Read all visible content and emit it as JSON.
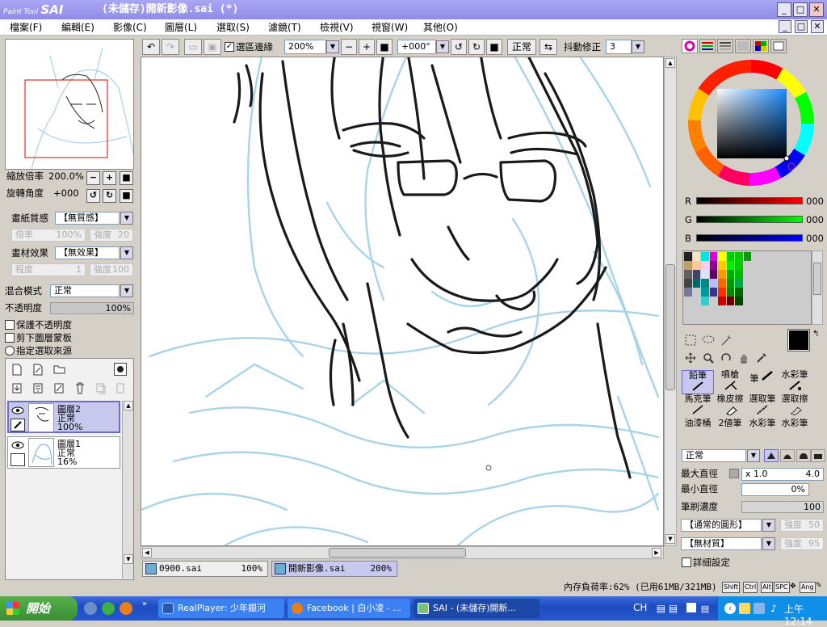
{
  "window": {
    "logo_small": "Paint Tool",
    "logo": "SAI",
    "title": "(未儲存)開新影像.sai (*)",
    "min": "_",
    "max": "□",
    "close": "✕"
  },
  "menu": {
    "items": [
      "檔案(F)",
      "編輯(E)",
      "影像(C)",
      "圖層(L)",
      "選取(S)",
      "濾鏡(T)",
      "檢視(V)",
      "視窗(W)",
      "其他(O)"
    ],
    "mdi_min": "_",
    "mdi_max": "□",
    "mdi_close": "✕"
  },
  "navigator": {
    "zoom_label": "縮放倍率",
    "zoom_value": "200.0%",
    "rotate_label": "旋轉角度",
    "rotate_value": "+000"
  },
  "paper": {
    "texture_label": "畫紙質感",
    "texture_value": "【無質感】",
    "scale_label": "倍率",
    "scale_value": "100%",
    "strength_label": "強度",
    "strength_value": "20",
    "effect_label": "畫材效果",
    "effect_value": "【無效果】",
    "degree_label": "程度",
    "degree_value": "1",
    "strength2_label": "強度",
    "strength2_value": "100"
  },
  "blend": {
    "label": "混合模式",
    "value": "正常",
    "opacity_label": "不透明度",
    "opacity_value": "100%",
    "opacity": 1.0,
    "opt1": "保護不透明度",
    "opt2": "剪下圖層蒙板",
    "opt3": "指定選取來源"
  },
  "layers": [
    {
      "name": "圖層2",
      "mode": "正常",
      "opacity": "100%"
    },
    {
      "name": "圖層1",
      "mode": "正常",
      "opacity": "16%"
    }
  ],
  "toolbar": {
    "show_selection": "選區邊緣",
    "zoom": "200%",
    "angle": "+000°",
    "mode": "正常",
    "stabilizer_label": "抖動修正",
    "stabilizer": "3"
  },
  "tabs": [
    {
      "name": "0900.sai",
      "zoom": "100%"
    },
    {
      "name": "開新影像.sai",
      "zoom": "200%"
    }
  ],
  "color": {
    "r_label": "R",
    "g_label": "G",
    "b_label": "B",
    "r": "000",
    "g": "000",
    "b": "000",
    "palette": [
      "#222222",
      "#f5e6c0",
      "#00e5e5",
      "#dd00dd",
      "#ffff00",
      "#00cc00",
      "#00cc00",
      "#00a000",
      "#c4a060",
      "#ffcc99",
      "#ffccee",
      "#990099",
      "#ffcc00",
      "#00ee00",
      "#00cc00",
      "#cccccc",
      "#606060",
      "#444466",
      "#e0e0ff",
      "#660066",
      "#ff9900",
      "#00aa00",
      "#00bb00",
      "#cccccc",
      "#444444",
      "#006666",
      "#008888",
      "#bbbbff",
      "#ff6600",
      "#009900",
      "#00aa44",
      "#cccccc",
      "#777799",
      "#cccccc",
      "#009999",
      "#333399",
      "#ff3300",
      "#008800",
      "#006600",
      "#cccccc",
      "#cccccc",
      "#cccccc",
      "#33cccc",
      "#cccccc",
      "#cc0000",
      "#660000",
      "#004400",
      "#cccccc"
    ]
  },
  "tools": [
    {
      "name": "鉛筆"
    },
    {
      "name": "噴槍"
    },
    {
      "name": "筆"
    },
    {
      "name": "水彩筆"
    },
    {
      "name": "馬克筆"
    },
    {
      "name": "橡皮擦"
    },
    {
      "name": "選取筆"
    },
    {
      "name": "選取擦"
    },
    {
      "name": "油漆桶"
    },
    {
      "name": "2値筆"
    },
    {
      "name": "水彩筆"
    },
    {
      "name": "水彩筆"
    }
  ],
  "brush": {
    "mode": "正常",
    "max_label": "最大直徑",
    "max_mult": "x 1.0",
    "max_value": "4.0",
    "min_label": "最小直徑",
    "min_value": "0%",
    "density_label": "筆刷濃度",
    "density_value": "100",
    "shape": "【通常的圓形】",
    "shape_strength_label": "強度",
    "shape_strength": "50",
    "texture": "【無材質】",
    "texture_strength_label": "強度",
    "texture_strength": "95",
    "detail": "詳細設定"
  },
  "status": {
    "memory": "內存負荷率:62% (已用61MB/321MB)",
    "keys": [
      "Shift",
      "Ctrl",
      "Alt",
      "SPC",
      "Ang"
    ]
  },
  "taskbar": {
    "start": "開始",
    "tasks": [
      "RealPlayer: 少年銀河",
      "Facebook | 白小凌 - ...",
      "SAI - (未儲存)開新..."
    ],
    "lang": "CH",
    "clock": "上午 12:14"
  }
}
